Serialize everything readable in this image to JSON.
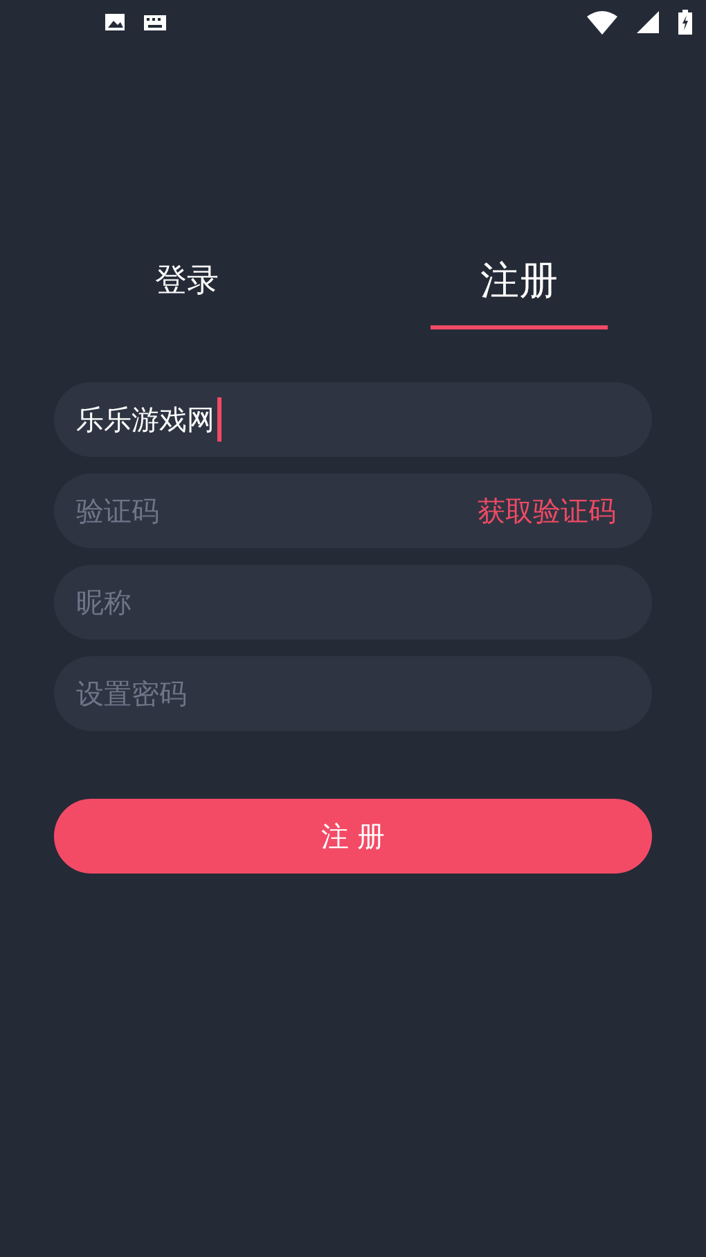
{
  "tabs": [
    {
      "label": "登录",
      "selected": false
    },
    {
      "label": "注册",
      "selected": true
    }
  ],
  "fields": [
    {
      "kind": "text",
      "value": "乐乐游戏网",
      "focused": true
    },
    {
      "kind": "code",
      "placeholder": "验证码",
      "focused": false,
      "action": "获取验证码"
    },
    {
      "kind": "text",
      "placeholder": "昵称",
      "focused": false
    },
    {
      "kind": "password",
      "placeholder": "设置密码",
      "focused": false
    }
  ],
  "submit_button": "注 册"
}
